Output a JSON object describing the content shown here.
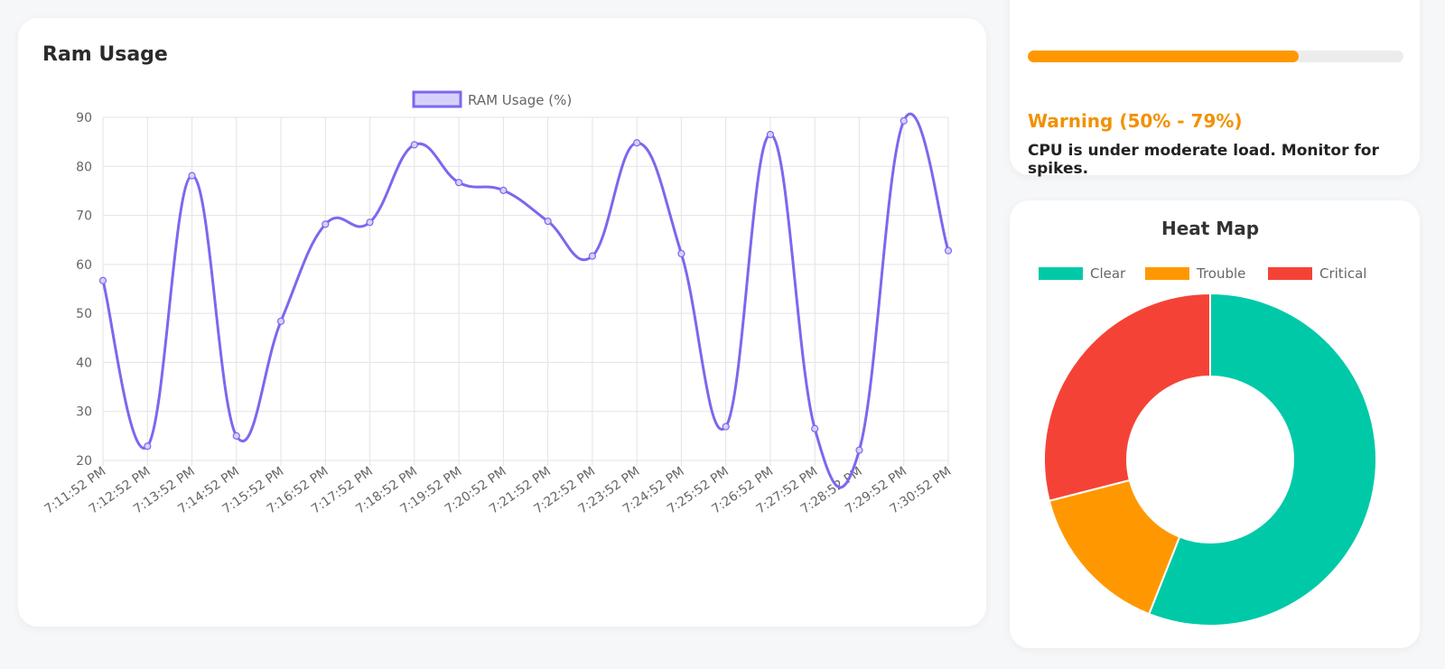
{
  "ram_card": {
    "title": "Ram Usage"
  },
  "cpu_card": {
    "progress_fraction": 0.72,
    "status_label": "Warning",
    "status_range": " (50% - 79%)",
    "message": "CPU is under moderate load. Monitor for spikes.",
    "colors": {
      "fill": "#ff9800",
      "track": "#ececec",
      "status": "#f29100"
    }
  },
  "heat_card": {
    "title": "Heat Map"
  },
  "chart_data": [
    {
      "type": "line",
      "title": "",
      "xlabel": "",
      "ylabel": "",
      "ylim": [
        20,
        90
      ],
      "yticks": [
        20,
        30,
        40,
        50,
        60,
        70,
        80,
        90
      ],
      "grid": true,
      "legend_position": "top",
      "categories": [
        "7:11:52 PM",
        "7:12:52 PM",
        "7:13:52 PM",
        "7:14:52 PM",
        "7:15:52 PM",
        "7:16:52 PM",
        "7:17:52 PM",
        "7:18:52 PM",
        "7:19:52 PM",
        "7:20:52 PM",
        "7:21:52 PM",
        "7:22:52 PM",
        "7:23:52 PM",
        "7:24:52 PM",
        "7:25:52 PM",
        "7:26:52 PM",
        "7:27:52 PM",
        "7:28:52 PM",
        "7:29:52 PM",
        "7:30:52 PM"
      ],
      "series": [
        {
          "name": "RAM Usage (%)",
          "color": "#7b68ee",
          "fill": "#d6d1fa",
          "values": [
            56.7,
            22.9,
            78.1,
            25.0,
            48.4,
            68.2,
            68.6,
            84.4,
            76.7,
            75.1,
            68.8,
            61.7,
            84.8,
            62.2,
            26.9,
            86.5,
            26.5,
            22.1,
            89.3,
            62.8
          ]
        }
      ]
    },
    {
      "type": "pie",
      "variant": "doughnut",
      "title": "Heat Map",
      "legend_position": "top",
      "slices": [
        {
          "label": "Clear",
          "value": 56,
          "color": "#00c9a7"
        },
        {
          "label": "Trouble",
          "value": 15,
          "color": "#ff9800"
        },
        {
          "label": "Critical",
          "value": 29,
          "color": "#f44336"
        }
      ]
    }
  ]
}
